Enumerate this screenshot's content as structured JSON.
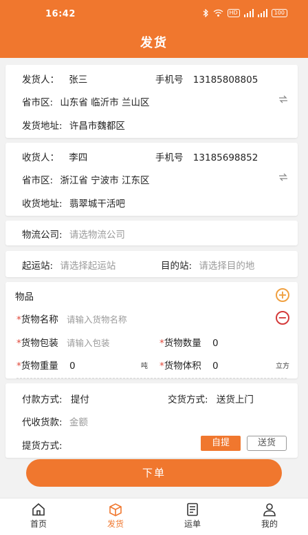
{
  "status": {
    "time": "16:42",
    "hd": "HD",
    "battery": "100"
  },
  "header": {
    "title": "发货"
  },
  "sender": {
    "name_label": "发货人：",
    "name": "张三",
    "phone_label": "手机号",
    "phone": "13185808805",
    "region_label": "省市区:",
    "region": "山东省 临沂市 兰山区",
    "address_label": "发货地址:",
    "address": "许昌市魏都区"
  },
  "receiver": {
    "name_label": "收货人：",
    "name": "李四",
    "phone_label": "手机号",
    "phone": "13185698852",
    "region_label": "省市区:",
    "region": "浙江省 宁波市 江东区",
    "address_label": "收货地址:",
    "address": "翡翠城干活吧"
  },
  "logistics": {
    "label": "物流公司:",
    "placeholder": "请选物流公司"
  },
  "route": {
    "from_label": "起运站:",
    "from_placeholder": "请选择起运站",
    "to_label": "目的站:",
    "to_placeholder": "请选择目的地"
  },
  "goods": {
    "section_label": "物品",
    "name_label": "货物名称",
    "name_placeholder": "请输入货物名称",
    "pack_label": "货物包装",
    "pack_placeholder": "请输入包装",
    "qty_label": "货物数量",
    "qty": "0",
    "weight_label": "货物重量",
    "weight": "0",
    "weight_unit": "吨",
    "volume_label": "货物体积",
    "volume": "0",
    "volume_unit": "立方",
    "required_mark": "*"
  },
  "payment": {
    "pay_label": "付款方式:",
    "pay": "提付",
    "delivery_label": "交货方式:",
    "delivery": "送货上门",
    "cod_label": "代收货款:",
    "cod_placeholder": "金额",
    "pickup_label": "提货方式:",
    "pickup_self": "自提",
    "pickup_deliver": "送货"
  },
  "submit_label": "下单",
  "tabs": [
    {
      "label": "首页"
    },
    {
      "label": "发货"
    },
    {
      "label": "运单"
    },
    {
      "label": "我的"
    }
  ],
  "colors": {
    "accent": "#f0772e",
    "required": "#e0483a"
  }
}
